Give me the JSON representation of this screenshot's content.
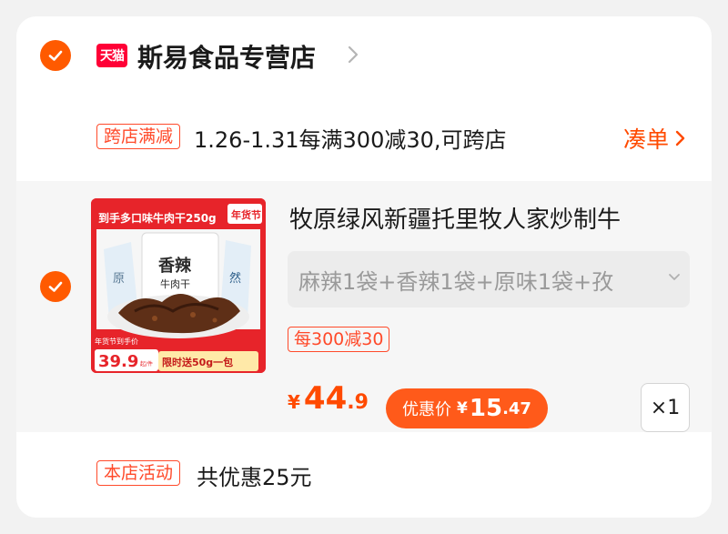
{
  "store": {
    "logo_text": "天猫",
    "name": "斯易食品专营店"
  },
  "promotion": {
    "tag": "跨店满减",
    "text": "1.26-1.31每满300减30,可跨店",
    "link": "凑单"
  },
  "item": {
    "title": "牧原绿风新疆托里牧人家炒制牛",
    "variant": "麻辣1袋+香辣1袋+原味1袋+孜",
    "offer_tag": "每300减30",
    "price_symbol": "¥",
    "price_int": "44",
    "price_dec": ".9",
    "deal_label": "优惠价",
    "deal_symbol": "¥",
    "deal_int": "15",
    "deal_dec": ".47",
    "quantity": "×1",
    "thumb": {
      "banner": "到手多口味牛肉干250g",
      "festival": "年货节",
      "pack_title": "香辣",
      "pack_sub": "牛肉干",
      "left_pack": "原",
      "right_pack": "然",
      "price_label": "年货节到手价",
      "price": "39.9",
      "price_unit": "起/件",
      "gift": "限时送50g一包"
    }
  },
  "activity": {
    "tag": "本店活动",
    "text": "共优惠25元"
  },
  "colors": {
    "accent": "#ff5a00",
    "tag_red": "#ff4a2a",
    "tmall_red": "#ff0036"
  }
}
